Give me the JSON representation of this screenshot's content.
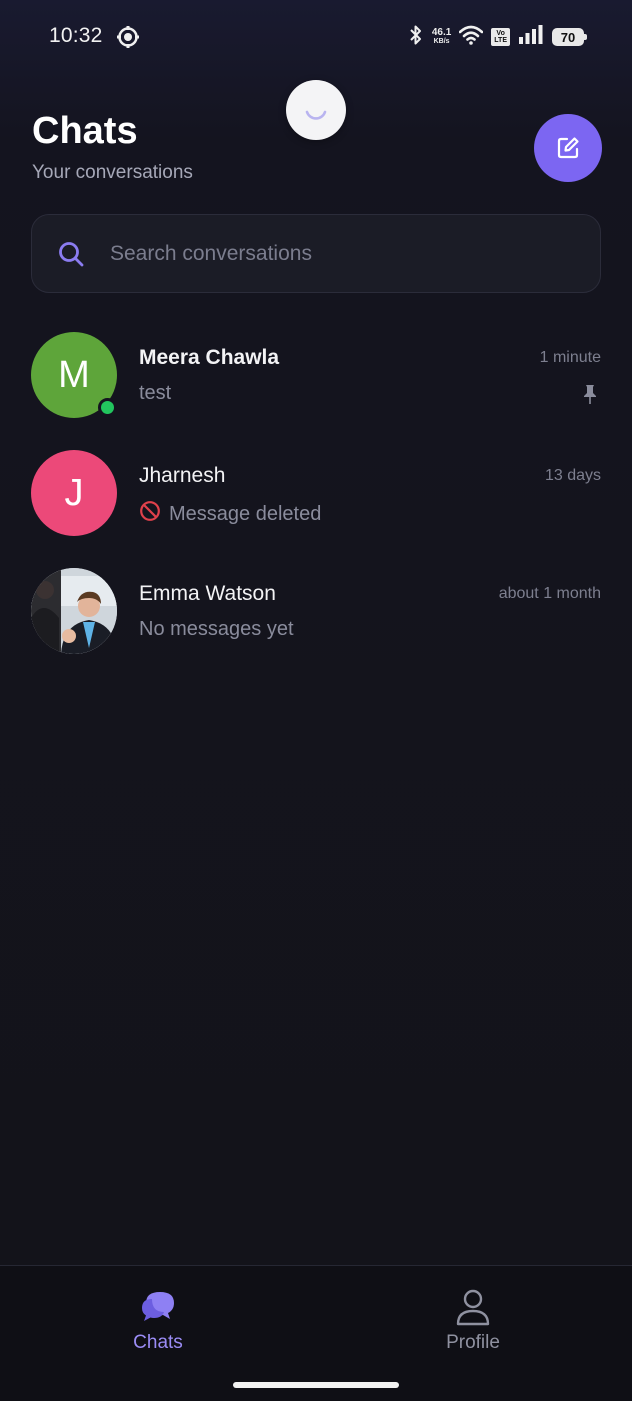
{
  "status_bar": {
    "time": "10:32",
    "net_speed_value": "46.1",
    "net_speed_unit": "KB/s",
    "volte_top": "Vo",
    "volte_bottom": "LTE",
    "battery": "70"
  },
  "header": {
    "title": "Chats",
    "subtitle": "Your conversations"
  },
  "search": {
    "placeholder": "Search conversations"
  },
  "chats": [
    {
      "name": "Meera Chawla",
      "initial": "M",
      "avatar_color": "#5ea53a",
      "preview": "test",
      "time": "1 minute",
      "online": true,
      "pinned": true
    },
    {
      "name": "Jharnesh",
      "initial": "J",
      "avatar_color": "#ec4979",
      "preview": "Message deleted",
      "time": "13 days",
      "deleted": true
    },
    {
      "name": "Emma Watson",
      "avatar": "photo",
      "preview": "No messages yet",
      "time": "about 1 month"
    }
  ],
  "bottom_nav": {
    "chats_label": "Chats",
    "profile_label": "Profile",
    "active": "Chats"
  },
  "colors": {
    "accent": "#7c66f2",
    "nav_active": "#9b8cf5",
    "nav_inactive": "#8f91a0",
    "online": "#22c55e",
    "deleted_icon": "#e0414b"
  }
}
